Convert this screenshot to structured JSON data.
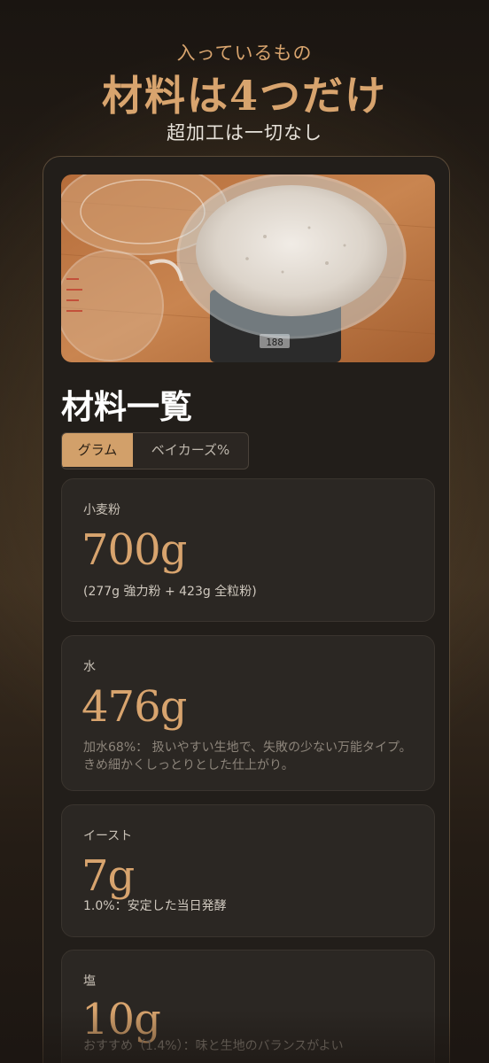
{
  "hero": {
    "eyebrow": "入っているもの",
    "headline": "材料は4つだけ",
    "subhead": "超加工は一切なし"
  },
  "section": {
    "title": "材料一覧"
  },
  "toggle": {
    "active_label": "グラム",
    "inactive_label": "ベイカーズ%"
  },
  "ingredients": [
    {
      "label": "小麦粉",
      "amount": "700g",
      "desc": "(277g 強力粉 + 423g 全粒粉)"
    },
    {
      "label": "水",
      "amount": "476g",
      "desc": "加水68%： 扱いやすい生地で、失敗の少ない万能タイプ。きめ細かくしっとりとした仕上がり。"
    },
    {
      "label": "イースト",
      "amount": "7g",
      "desc": "1.0%：安定した当日発酵"
    },
    {
      "label": "塩",
      "amount": "10g",
      "desc": "おすすめ（1.4%）：味と生地のバランスがよい"
    }
  ],
  "photo": {
    "scale_display": "188"
  },
  "colors": {
    "accent": "#d8a46e",
    "card_bg": "#221e1a",
    "toggle_active": "#d2a06a"
  }
}
